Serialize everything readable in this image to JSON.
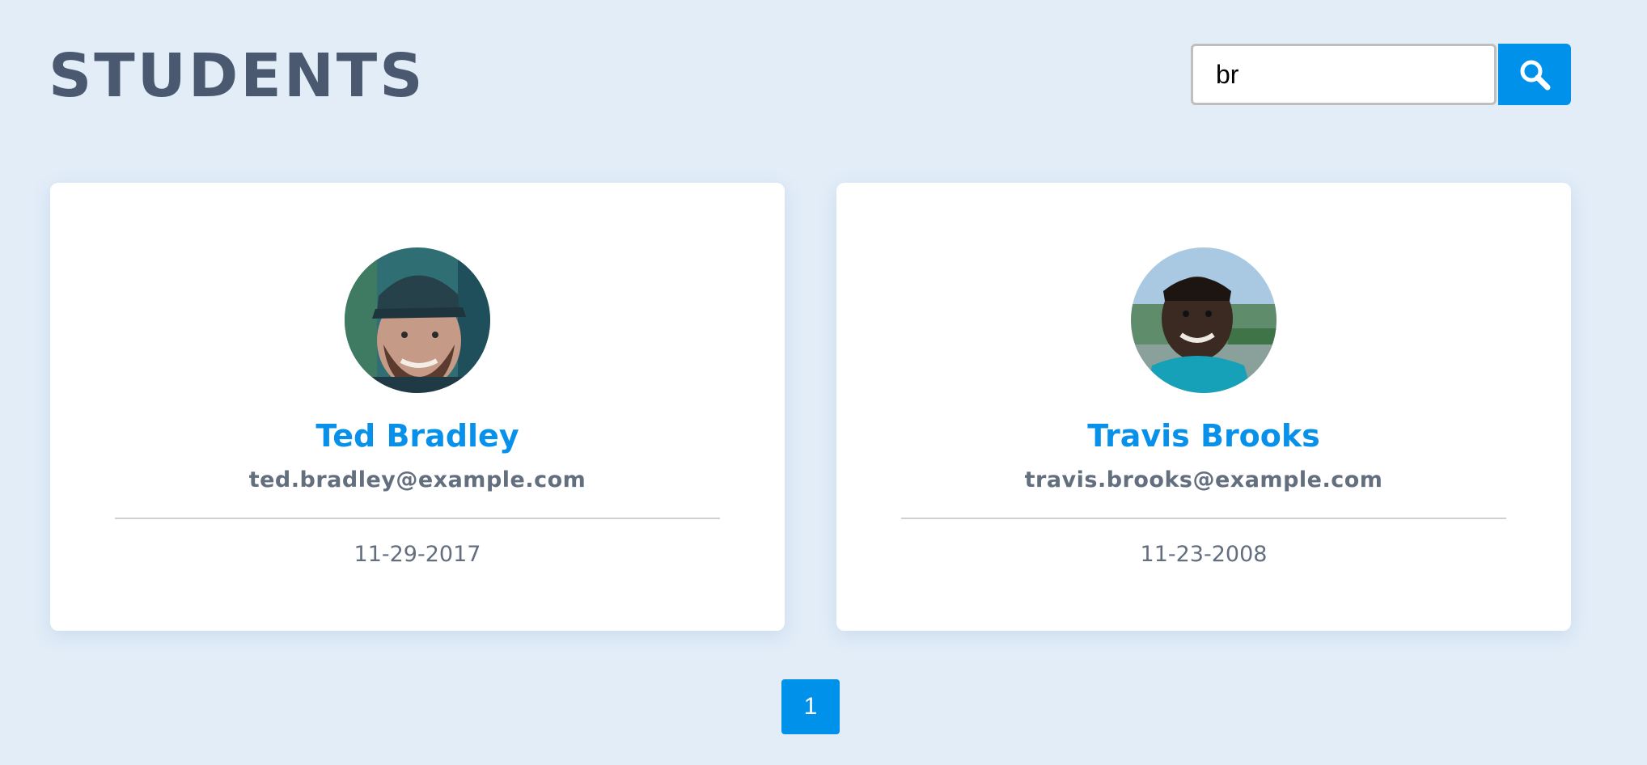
{
  "header": {
    "title": "STUDENTS"
  },
  "search": {
    "value": "br",
    "icon": "search-icon"
  },
  "students": [
    {
      "name": "Ted Bradley",
      "email": "ted.bradley@example.com",
      "date": "11-29-2017",
      "avatar": "avatar-photo"
    },
    {
      "name": "Travis Brooks",
      "email": "travis.brooks@example.com",
      "date": "11-23-2008",
      "avatar": "avatar-photo"
    }
  ],
  "pagination": {
    "current_page": "1"
  },
  "colors": {
    "background": "#e2edf8",
    "accent": "#0091ea",
    "name_text": "#0891ea",
    "title_text": "#4a5970",
    "muted_text": "#636e7f",
    "card": "#ffffff"
  }
}
